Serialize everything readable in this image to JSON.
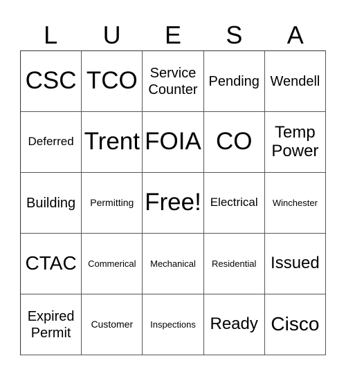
{
  "header": [
    "L",
    "U",
    "E",
    "S",
    "A"
  ],
  "cells": [
    [
      "CSC",
      "TCO",
      "Service Counter",
      "Pending",
      "Wendell"
    ],
    [
      "Deferred",
      "Trent",
      "FOIA",
      "CO",
      "Temp Power"
    ],
    [
      "Building",
      "Permitting",
      "Free!",
      "Electrical",
      "Winchester"
    ],
    [
      "CTAC",
      "Commerical",
      "Mechanical",
      "Residential",
      "Issued"
    ],
    [
      "Expired Permit",
      "Customer",
      "Inspections",
      "Ready",
      "Cisco"
    ]
  ]
}
